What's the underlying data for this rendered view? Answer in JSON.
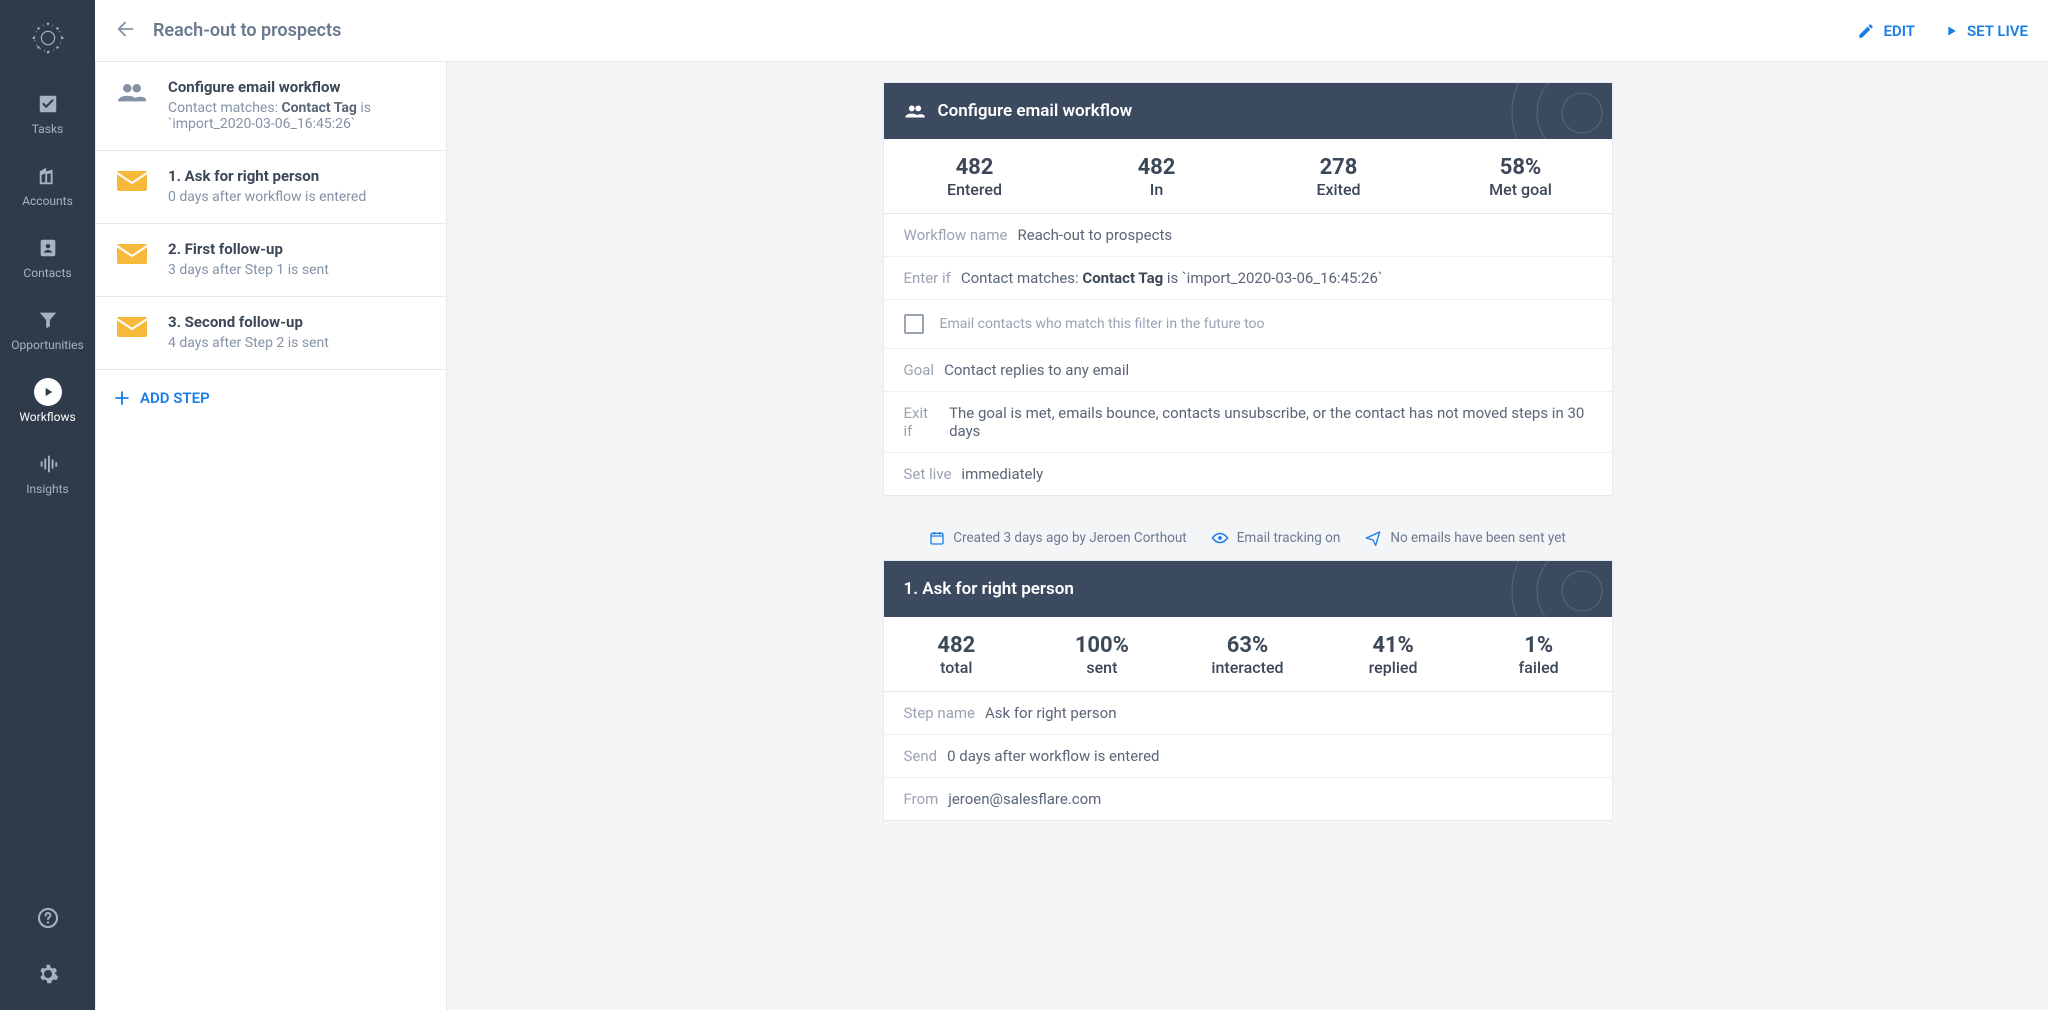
{
  "nav": {
    "tasks": "Tasks",
    "accounts": "Accounts",
    "contacts": "Contacts",
    "opportunities": "Opportunities",
    "workflows": "Workflows",
    "insights": "Insights"
  },
  "header": {
    "title": "Reach-out to prospects",
    "edit": "EDIT",
    "setlive": "SET LIVE"
  },
  "steps": {
    "config_title": "Configure email workflow",
    "config_sub_prefix": "Contact matches: ",
    "config_sub_bold": "Contact Tag",
    "config_sub_mid": " is",
    "config_sub_code": "`import_2020-03-06_16:45:26`",
    "list": [
      {
        "title": "1. Ask for right person",
        "sub": "0 days after workflow is entered"
      },
      {
        "title": "2. First follow-up",
        "sub": "3 days after Step 1 is sent"
      },
      {
        "title": "3. Second follow-up",
        "sub": "4 days after Step 2 is sent"
      }
    ],
    "add": "ADD STEP"
  },
  "workflow_card": {
    "title": "Configure email workflow",
    "stats": [
      {
        "num": "482",
        "lbl": "Entered"
      },
      {
        "num": "482",
        "lbl": "In"
      },
      {
        "num": "278",
        "lbl": "Exited"
      },
      {
        "num": "58%",
        "lbl": "Met goal"
      }
    ],
    "rows": {
      "wf_name_lbl": "Workflow name",
      "wf_name_val": "Reach-out to prospects",
      "enter_lbl": "Enter if",
      "enter_prefix": "Contact matches: ",
      "enter_bold": "Contact Tag",
      "enter_mid": " is ",
      "enter_code": "`import_2020-03-06_16:45:26`",
      "future_lbl": "Email contacts who match this filter in the future too",
      "goal_lbl": "Goal",
      "goal_val": "Contact replies to any email",
      "exit_lbl": "Exit if",
      "exit_val": "The goal is met, emails bounce, contacts unsubscribe, or the contact has not moved steps in 30 days",
      "setlive_lbl": "Set live",
      "setlive_val": "immediately"
    }
  },
  "meta": {
    "created": "Created 3 days ago by Jeroen Corthout",
    "tracking": "Email tracking on",
    "sent": "No emails have been sent yet"
  },
  "step_card": {
    "title": "1. Ask for right person",
    "stats": [
      {
        "num": "482",
        "lbl": "total"
      },
      {
        "num": "100%",
        "lbl": "sent"
      },
      {
        "num": "63%",
        "lbl": "interacted"
      },
      {
        "num": "41%",
        "lbl": "replied"
      },
      {
        "num": "1%",
        "lbl": "failed"
      }
    ],
    "rows": {
      "name_lbl": "Step name",
      "name_val": "Ask for right person",
      "send_lbl": "Send",
      "send_val": "0 days after workflow is entered",
      "from_lbl": "From",
      "from_val": "jeroen@salesflare.com"
    }
  }
}
